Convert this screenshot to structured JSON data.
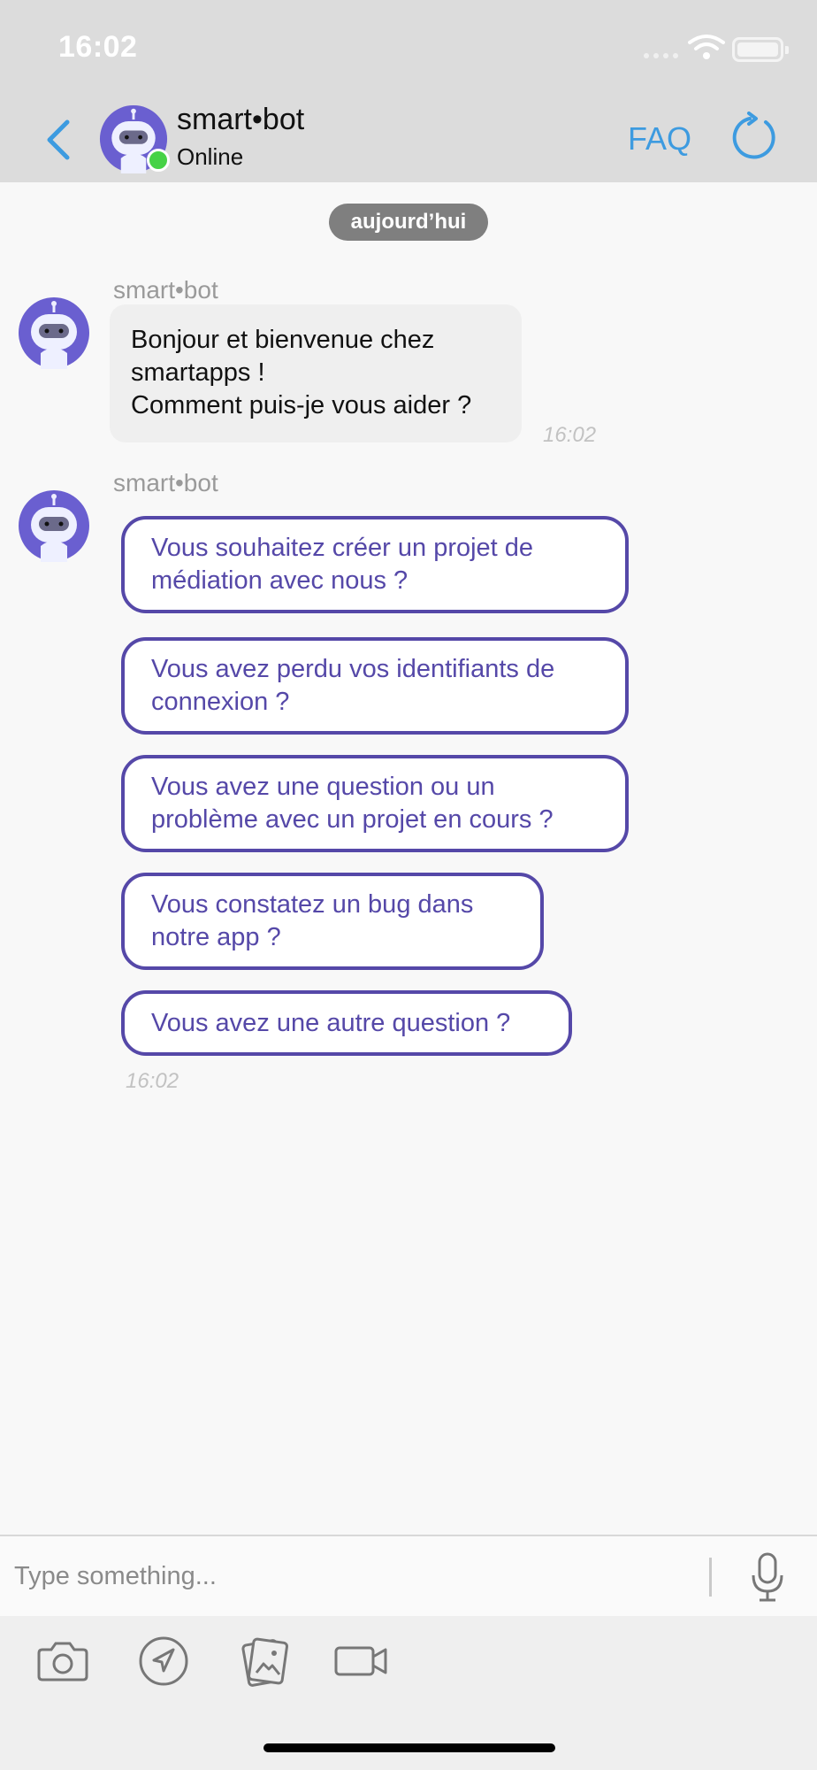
{
  "status_bar": {
    "time": "16:02"
  },
  "header": {
    "name": "smart•bot",
    "status": "Online",
    "faq_label": "FAQ"
  },
  "chat": {
    "date_label": "aujourd’hui",
    "messages": [
      {
        "sender": "smart•bot",
        "lines": [
          "Bonjour et bienvenue chez",
          "smartapps !",
          "Comment puis-je vous aider ?"
        ],
        "time": "16:02"
      },
      {
        "sender": "smart•bot",
        "options": [
          {
            "lines": [
              "Vous souhaitez créer un projet de",
              "médiation avec nous ?"
            ]
          },
          {
            "lines": [
              "Vous avez perdu vos identifiants de",
              "connexion ?"
            ]
          },
          {
            "lines": [
              "Vous avez une question ou un",
              "problème avec un projet en cours ?"
            ]
          },
          {
            "lines": [
              "Vous constatez un bug dans",
              "notre app ?"
            ]
          },
          {
            "lines": [
              "Vous avez une autre question ?"
            ]
          }
        ],
        "time": "16:02"
      }
    ]
  },
  "composer": {
    "placeholder": "Type something..."
  },
  "toolbar": {
    "icons": [
      "camera-icon",
      "send-location-icon",
      "gallery-icon",
      "video-icon"
    ]
  },
  "colors": {
    "accent": "#5548a8",
    "link": "#3d9be0",
    "online": "#46d246",
    "avatar": "#6a5fd0"
  }
}
